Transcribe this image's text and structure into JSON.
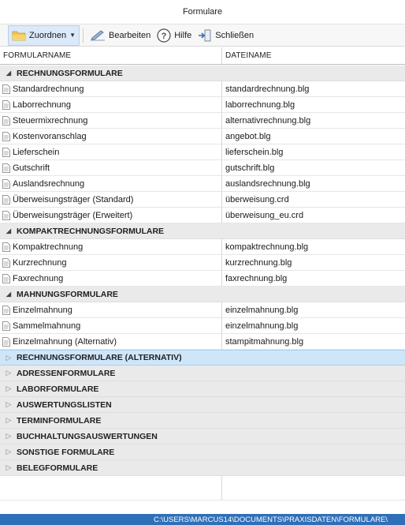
{
  "window": {
    "title": "Formulare"
  },
  "toolbar": {
    "zuordnen": "Zuordnen",
    "bearbeiten": "Bearbeiten",
    "hilfe": "Hilfe",
    "schliessen": "Schließen"
  },
  "columns": {
    "name": "FORMULARNAME",
    "file": "DATEINAME"
  },
  "groups": [
    {
      "label": "RECHNUNGSFORMULARE",
      "expanded": true,
      "rows": [
        {
          "name": "Standardrechnung",
          "file": "standardrechnung.blg"
        },
        {
          "name": "Laborrechnung",
          "file": "laborrechnung.blg"
        },
        {
          "name": "Steuermixrechnung",
          "file": "alternativrechnung.blg"
        },
        {
          "name": "Kostenvoranschlag",
          "file": "angebot.blg"
        },
        {
          "name": "Lieferschein",
          "file": "lieferschein.blg"
        },
        {
          "name": "Gutschrift",
          "file": "gutschrift.blg"
        },
        {
          "name": "Auslandsrechnung",
          "file": "auslandsrechnung.blg"
        },
        {
          "name": "Überweisungsträger (Standard)",
          "file": "überweisung.crd"
        },
        {
          "name": "Überweisungsträger (Erweitert)",
          "file": "überweisung_eu.crd"
        }
      ]
    },
    {
      "label": "KOMPAKTRECHNUNGSFORMULARE",
      "expanded": true,
      "rows": [
        {
          "name": "Kompaktrechnung",
          "file": "kompaktrechnung.blg"
        },
        {
          "name": "Kurzrechnung",
          "file": "kurzrechnung.blg"
        },
        {
          "name": "Faxrechnung",
          "file": "faxrechnung.blg"
        }
      ]
    },
    {
      "label": "MAHNUNGSFORMULARE",
      "expanded": true,
      "rows": [
        {
          "name": "Einzelmahnung",
          "file": "einzelmahnung.blg"
        },
        {
          "name": "Sammelmahnung",
          "file": "einzelmahnung.blg"
        },
        {
          "name": "Einzelmahnung (Alternativ)",
          "file": "stampitmahnung.blg"
        }
      ]
    },
    {
      "label": "RECHNUNGSFORMULARE (ALTERNATIV)",
      "expanded": false,
      "selected": true,
      "rows": []
    },
    {
      "label": "ADRESSENFORMULARE",
      "expanded": false,
      "rows": []
    },
    {
      "label": "LABORFORMULARE",
      "expanded": false,
      "rows": []
    },
    {
      "label": "AUSWERTUNGSLISTEN",
      "expanded": false,
      "rows": []
    },
    {
      "label": "TERMINFORMULARE",
      "expanded": false,
      "rows": []
    },
    {
      "label": "BUCHHALTUNGSAUSWERTUNGEN",
      "expanded": false,
      "rows": []
    },
    {
      "label": "SONSTIGE FORMULARE",
      "expanded": false,
      "rows": []
    },
    {
      "label": "BELEGFORMULARE",
      "expanded": false,
      "rows": []
    }
  ],
  "status": {
    "path": "C:\\USERS\\MARCUS14\\DOCUMENTS\\PRAXISDATEN\\FORMULARE\\"
  },
  "colors": {
    "accent": "#2f6fb8",
    "selected_row": "#cfe6f9",
    "group_bg": "#eaeaea"
  }
}
